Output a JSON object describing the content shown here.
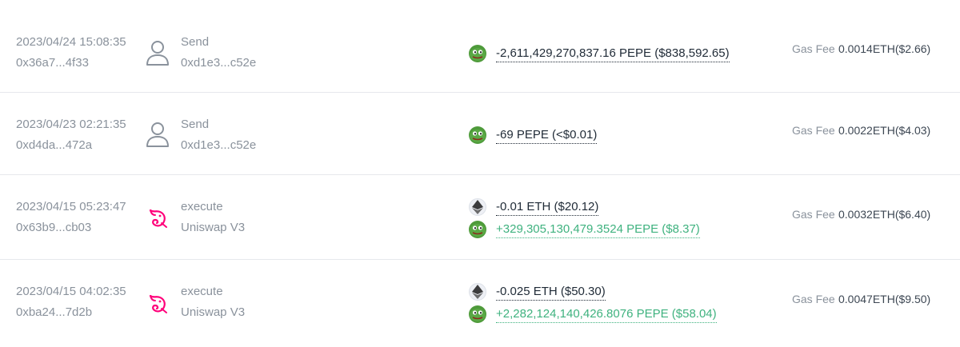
{
  "transactions": [
    {
      "time": "2023/04/24 15:08:35",
      "hash": "0x36a7...4f33",
      "action": "Send",
      "target": "0xd1e3...c52e",
      "icon": "user-icon",
      "transfers": [
        {
          "token": "pepe-token-icon",
          "text": "-2,611,429,270,837.16 PEPE ($838,592.65)",
          "direction": "out"
        }
      ],
      "gas_label": "Gas Fee",
      "gas_value": "0.0014ETH($2.66)"
    },
    {
      "time": "2023/04/23 02:21:35",
      "hash": "0xd4da...472a",
      "action": "Send",
      "target": "0xd1e3...c52e",
      "icon": "user-icon",
      "transfers": [
        {
          "token": "pepe-token-icon",
          "text": "-69 PEPE (<$0.01)",
          "direction": "out"
        }
      ],
      "gas_label": "Gas Fee",
      "gas_value": "0.0022ETH($4.03)"
    },
    {
      "time": "2023/04/15 05:23:47",
      "hash": "0x63b9...cb03",
      "action": "execute",
      "target": "Uniswap V3",
      "icon": "uniswap-icon",
      "transfers": [
        {
          "token": "eth-token-icon",
          "text": "-0.01 ETH ($20.12)",
          "direction": "out"
        },
        {
          "token": "pepe-token-icon",
          "text": "+329,305,130,479.3524 PEPE ($8.37)",
          "direction": "in"
        }
      ],
      "gas_label": "Gas Fee",
      "gas_value": "0.0032ETH($6.40)"
    },
    {
      "time": "2023/04/15 04:02:35",
      "hash": "0xba24...7d2b",
      "action": "execute",
      "target": "Uniswap V3",
      "icon": "uniswap-icon",
      "transfers": [
        {
          "token": "eth-token-icon",
          "text": "-0.025 ETH ($50.30)",
          "direction": "out"
        },
        {
          "token": "pepe-token-icon",
          "text": "+2,282,124,140,426.8076 PEPE ($58.04)",
          "direction": "in"
        }
      ],
      "gas_label": "Gas Fee",
      "gas_value": "0.0047ETH($9.50)"
    }
  ],
  "colors": {
    "positive": "#3fb27f",
    "negative": "#1f2a36",
    "muted": "#8a929c",
    "pepe_green": "#4e9a3a",
    "uniswap_pink": "#ff007a"
  }
}
